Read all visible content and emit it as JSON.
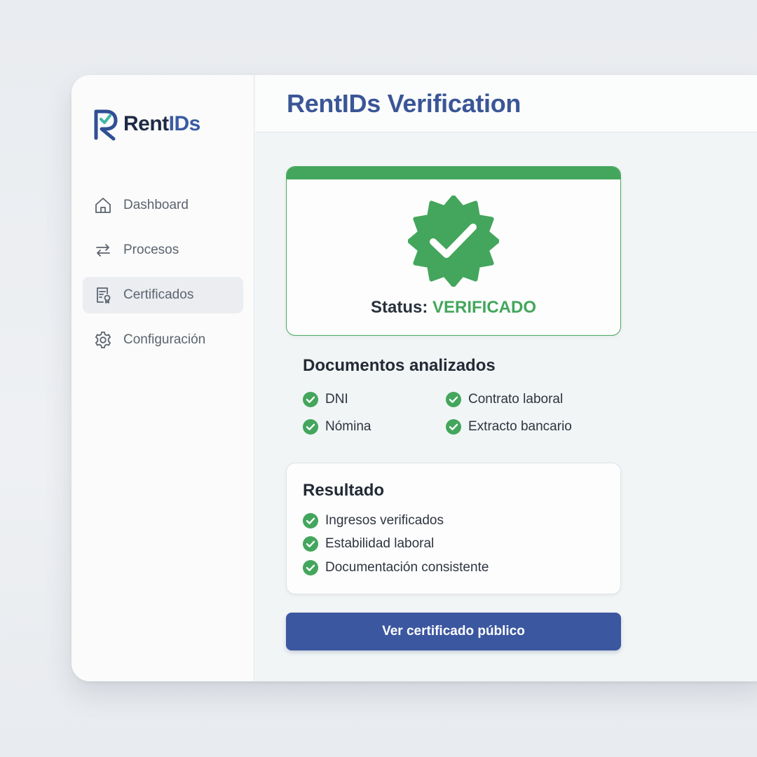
{
  "brand": {
    "name_part1": "Rent",
    "name_part2": "IDs"
  },
  "sidebar": {
    "items": [
      {
        "label": "Dashboard",
        "icon": "home-icon"
      },
      {
        "label": "Procesos",
        "icon": "swap-arrows-icon"
      },
      {
        "label": "Certificados",
        "icon": "certificate-icon",
        "active": true
      },
      {
        "label": "Configuración",
        "icon": "gear-icon"
      }
    ]
  },
  "header": {
    "title": "RentIDs Verification"
  },
  "status": {
    "label": "Status:",
    "value": "VERIFICADO",
    "icon": "verified-badge-icon"
  },
  "documents": {
    "title": "Documentos analizados",
    "items": [
      "DNI",
      "Contrato laboral",
      "Nómina",
      "Extracto bancario"
    ]
  },
  "result": {
    "title": "Resultado",
    "items": [
      "Ingresos verificados",
      "Estabilidad laboral",
      "Documentación consistente"
    ]
  },
  "cta": {
    "label": "Ver certificado público"
  },
  "colors": {
    "brand_blue": "#3a5696",
    "success_green": "#43a65c",
    "button_blue": "#3b57a0"
  }
}
